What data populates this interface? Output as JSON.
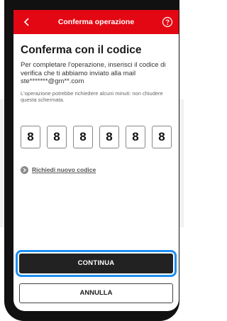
{
  "header": {
    "title": "Conferma operazione",
    "back_icon": "chevron-left-icon",
    "help_icon": "question-circle-icon",
    "color": "#e30613"
  },
  "main": {
    "title": "Conferma con il codice",
    "description": "Per completare l'operazione, inserisci il codice di verifica che ti abbiamo inviato alla mail ste*******@gm**.com",
    "note": "L'operazione potrebbe richiedere alcuni minuti: non chiudere questa schermata.",
    "code_digits": [
      "8",
      "8",
      "8",
      "8",
      "8",
      "8"
    ],
    "resend_label": "Richiedi nuovo codice",
    "resend_icon": "arrow-right-circle-icon"
  },
  "actions": {
    "continue_label": "CONTINUA",
    "cancel_label": "ANNULLA",
    "focus_color": "#1f8ef1"
  }
}
